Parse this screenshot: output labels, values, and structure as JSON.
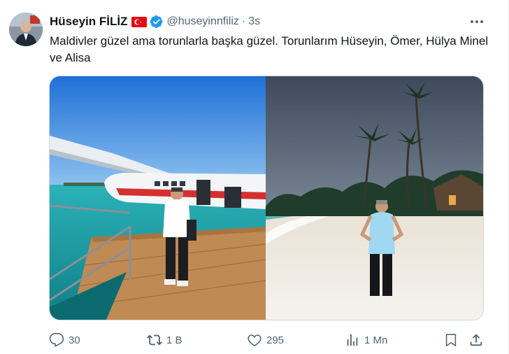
{
  "tweet": {
    "author_name": "Hüseyin FİLİZ",
    "handle": "@huseyinnfiliz",
    "separator": "·",
    "time": "3s",
    "text": "Maldivler güzel ama torunlarla başka güzel. Torunlarım Hüseyin, Ömer, Hülya Minel ve Alisa"
  },
  "media": {
    "photos": [
      "seaplane-dock-photo",
      "beach-palm-photo"
    ]
  },
  "actions": {
    "reply_count": "30",
    "retweet_count": "1 B",
    "like_count": "295",
    "views_count": "1 Mn"
  },
  "icons": [
    "turkey-flag-icon",
    "verified-badge-icon",
    "more-icon",
    "reply-icon",
    "retweet-icon",
    "like-icon",
    "views-icon",
    "bookmark-icon",
    "share-icon"
  ],
  "colors": {
    "verified": "#1d9bf0",
    "flag_red": "#e30a17",
    "secondary_text": "#536471",
    "primary_text": "#0f1419"
  }
}
